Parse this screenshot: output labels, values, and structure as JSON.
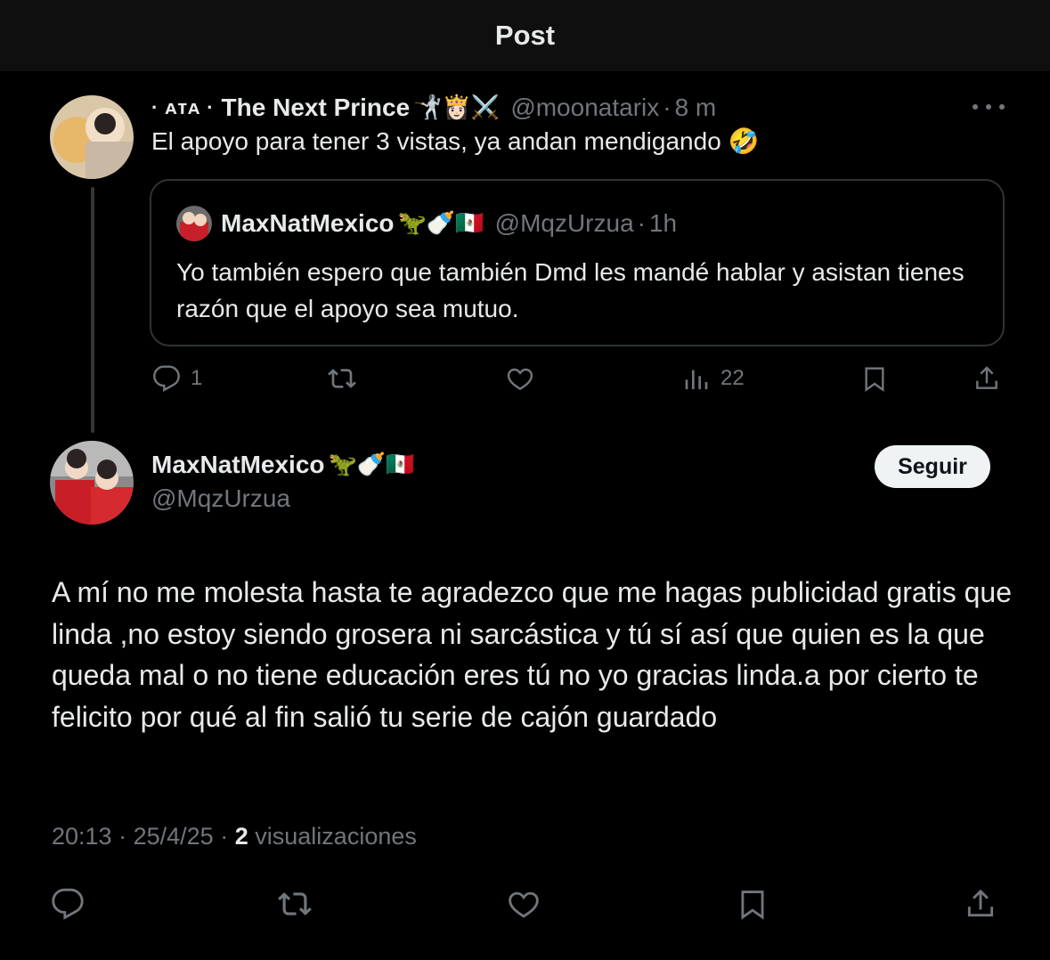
{
  "header": {
    "title": "Post"
  },
  "tweet1": {
    "name_prefix": "· ᴀᴛᴀ ·",
    "name": "The Next Prince",
    "emojis": "🤺👸🏻⚔️",
    "handle": "@moonatarix",
    "separator": "·",
    "time": "8 m",
    "text": "El apoyo para tener 3 vistas, ya andan mendigando 🤣",
    "quote": {
      "name": "MaxNatMexico",
      "emojis": "🦖🍼🇲🇽",
      "handle": "@MqzUrzua",
      "separator": "·",
      "time": "1h",
      "text": "Yo también espero que también Dmd les mandé hablar y asistan tienes razón que el apoyo sea mutuo."
    },
    "actions": {
      "replies": "1",
      "retweets": "",
      "likes": "",
      "views": "22"
    }
  },
  "tweet2": {
    "name": "MaxNatMexico",
    "emojis": "🦖🍼🇲🇽",
    "handle": "@MqzUrzua",
    "follow_label": "Seguir",
    "text": "A mí no me molesta hasta te agradezco que me hagas publicidad gratis que linda ,no estoy siendo grosera ni sarcástica y tú sí así que quien es la que queda mal o no tiene educación eres tú no yo gracias linda.a por cierto te felicito por qué al fin salió tu serie de cajón guardado",
    "time": "20:13",
    "date": "25/4/25",
    "separator": "·",
    "views_count": "2",
    "views_label": "visualizaciones"
  },
  "icons": {
    "reply": "reply-icon",
    "retweet": "retweet-icon",
    "like": "heart-icon",
    "views": "views-icon",
    "bookmark": "bookmark-icon",
    "share": "share-icon",
    "more": "more-icon"
  },
  "colors": {
    "background": "#000000",
    "topbar": "#0f0f0f",
    "text": "#e7e9ea",
    "muted": "#71767b",
    "border": "#2f3336",
    "button_bg": "#eff3f4"
  }
}
